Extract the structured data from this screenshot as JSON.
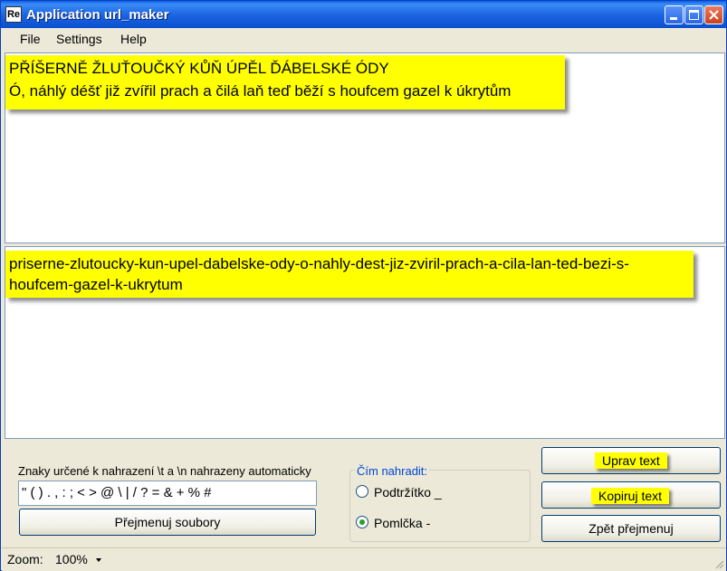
{
  "window": {
    "icon_text": "Re",
    "title": "Application url_maker"
  },
  "menu": {
    "file": "File",
    "settings": "Settings",
    "help": "Help"
  },
  "input_text": {
    "line1": "PŘÍŠERNĚ ŽLUŤOUČKÝ KŮŇ ÚPĚL ĎÁBELSKÉ ÓDY",
    "line2": "Ó, náhlý déšť již zvířil prach a čilá laň teď běží s houfcem gazel k úkrytům"
  },
  "output_text": {
    "line1": "priserne-zlutoucky-kun-upel-dabelske-ody-o-nahly-dest-jiz-zviril-prach-a-cila-lan-ted-bezi-s-",
    "line2": "houfcem-gazel-k-ukrytum"
  },
  "controls": {
    "chars_label": "Znaky určené k nahrazení \\t a \\n nahrazeny automaticky",
    "chars_value": "\" ( ) . , : ; < > @ \\ | / ? = & + % #",
    "rename_button": "Přejmenuj soubory",
    "replace_group_title": "Čím nahradit:",
    "option_underscore": "Podtržítko _",
    "option_dash": "Pomlčka -",
    "edit_button": "Uprav text",
    "copy_button": "Kopiruj text",
    "undo_rename_button": "Zpět přejmenuj"
  },
  "status": {
    "zoom_label": "Zoom:",
    "zoom_value": "100%"
  }
}
